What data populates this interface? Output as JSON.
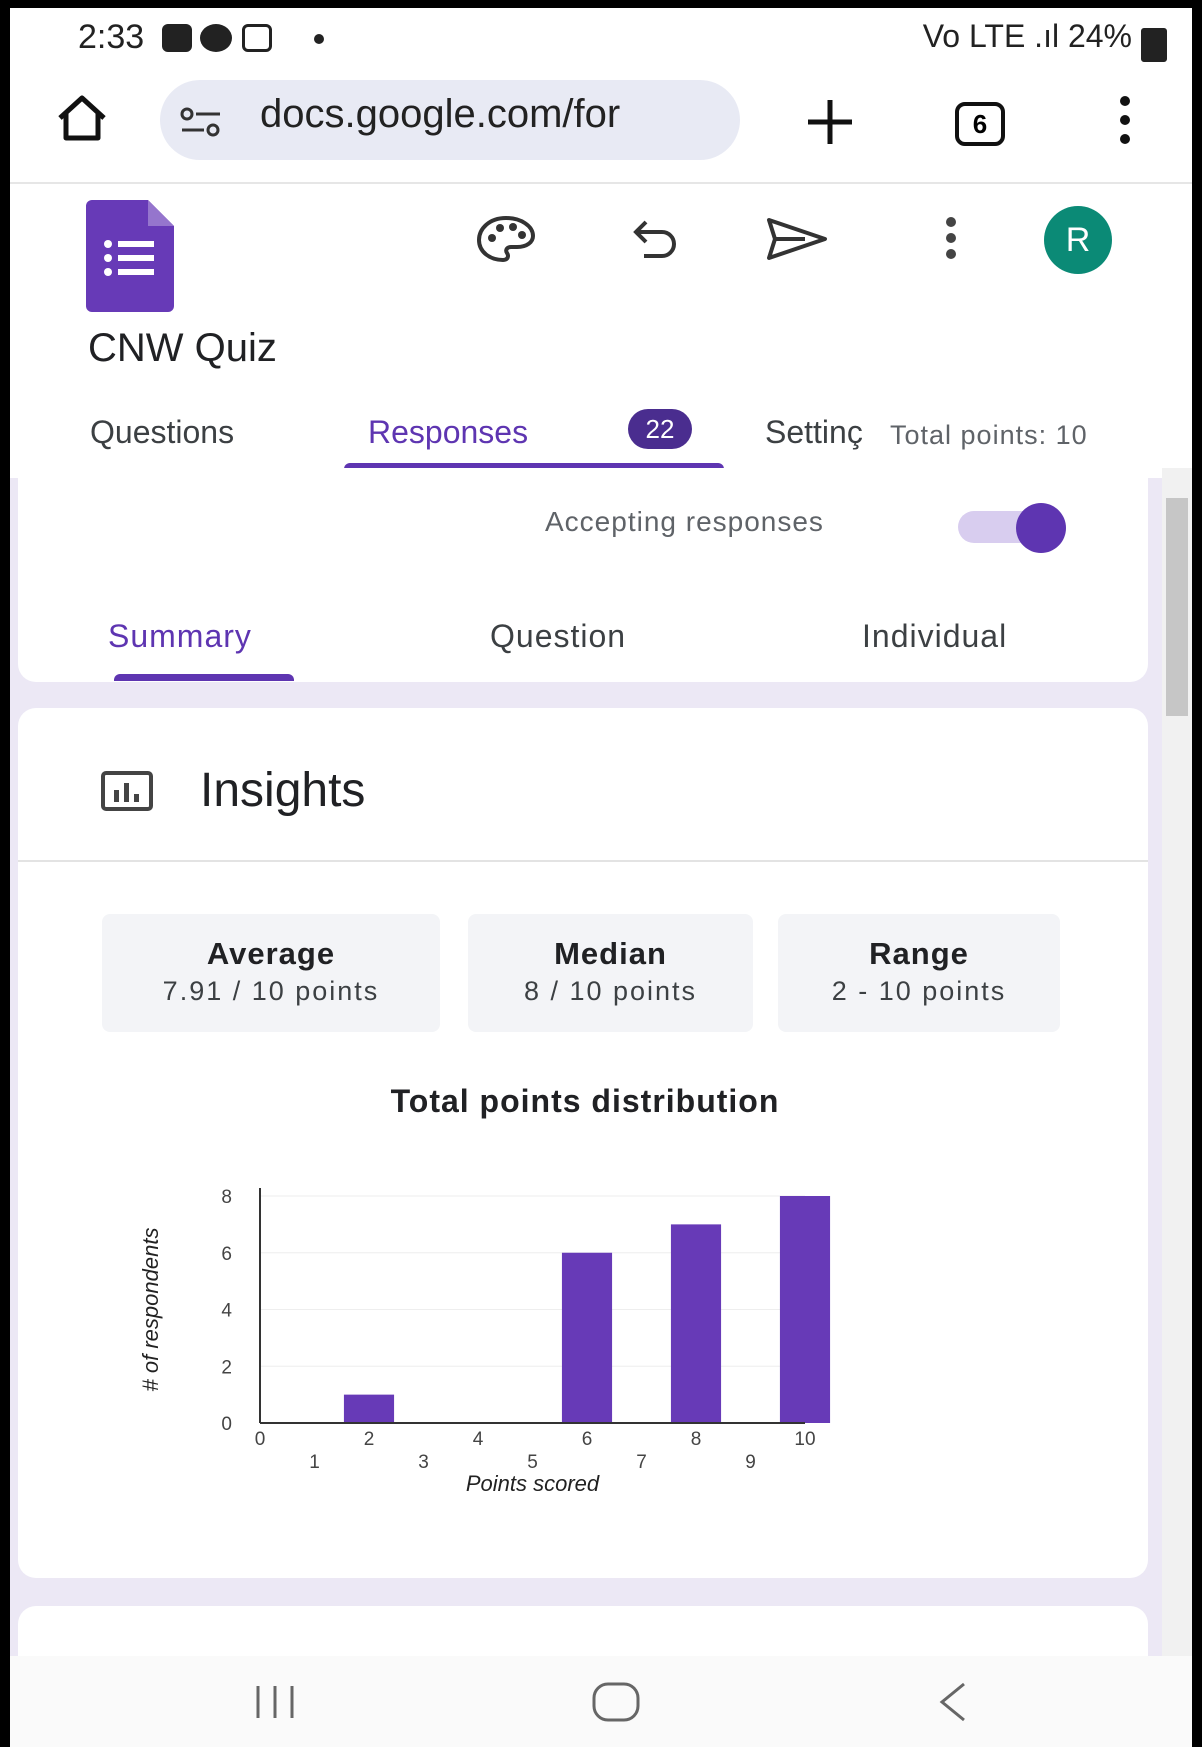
{
  "status_bar": {
    "time": "2:33",
    "right_text": "Vo LTE .ıl 24%"
  },
  "browser": {
    "url": "docs.google.com/for",
    "tab_count": "6"
  },
  "app": {
    "title": "CNW Quiz",
    "tabs": {
      "questions": "Questions",
      "responses": "Responses",
      "responses_count": "22",
      "settings": "Settinç"
    },
    "total_points": "Total points: 10",
    "avatar_letter": "R",
    "brand_color": "#5e35b1"
  },
  "responses": {
    "accepting_label": "Accepting responses",
    "accepting_on": true,
    "subtabs": {
      "summary": "Summary",
      "question": "Question",
      "individual": "Individual"
    }
  },
  "insights": {
    "title": "Insights",
    "stats": [
      {
        "label": "Average",
        "value": "7.91 / 10 points"
      },
      {
        "label": "Median",
        "value": "8 / 10 points"
      },
      {
        "label": "Range",
        "value": "2 - 10 points"
      }
    ]
  },
  "chart_data": {
    "type": "bar",
    "title": "Total points distribution",
    "xlabel": "Points scored",
    "ylabel": "# of respondents",
    "categories": [
      0,
      1,
      2,
      3,
      4,
      5,
      6,
      7,
      8,
      9,
      10
    ],
    "values": [
      0,
      0,
      1,
      0,
      0,
      0,
      6,
      0,
      7,
      0,
      8
    ],
    "ylim": [
      0,
      8
    ],
    "yticks": [
      0,
      2,
      4,
      6,
      8
    ],
    "grid": true,
    "bar_color": "#673ab7"
  }
}
